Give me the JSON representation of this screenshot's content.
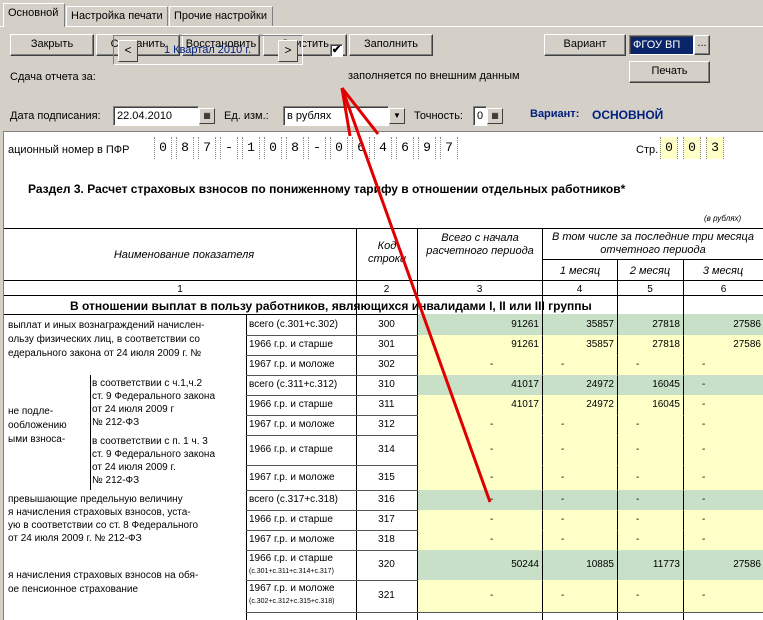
{
  "tabs": [
    "Основной",
    "Настройка печати",
    "Прочие настройки"
  ],
  "toolbar": {
    "close": "Закрыть",
    "save": "Сохранить",
    "restore": "Восстановить",
    "clear": "Очистить",
    "fill": "Заполнить",
    "variant": "Вариант",
    "variant_value": "ФГОУ ВП",
    "ellipsis": "...",
    "print": "Печать"
  },
  "period": {
    "label": "Сдача отчета за:",
    "value": "1 Квартал 2010 г.",
    "prev": "<",
    "next": ">"
  },
  "external": {
    "checked": "✔",
    "label": "заполняется по внешним данным"
  },
  "sign": {
    "date_label": "Дата подписания:",
    "date_value": "22.04.2010",
    "unit_label": "Ед. изм.:",
    "unit_value": "в рублях",
    "precision_label": "Точность:",
    "precision_value": "0",
    "variant_label": "Вариант:",
    "variant_value": "ОСНОВНОЙ"
  },
  "sheet": {
    "reg_label": "ационный номер в ПФР",
    "reg_digits": [
      "0",
      "8",
      "7",
      "-",
      "1",
      "0",
      "8",
      "-",
      "0",
      "6",
      "4",
      "6",
      "9",
      "7"
    ],
    "page_label": "Стр.",
    "page_digits": [
      "0",
      "0",
      "3"
    ],
    "section_title": "Раздел 3. Расчет страховых взносов по пониженному тарифу в отношении отдельных работников*",
    "units_note": "(в рублях)",
    "headers": {
      "name": "Наименование показателя",
      "code": "Код строки",
      "total": "Всего с начала расчетного периода",
      "last3": "В том числе за последние три месяца отчетного периода",
      "m1": "1 месяц",
      "m2": "2 месяц",
      "m3": "3 месяц",
      "n1": "1",
      "n2": "2",
      "n3": "3",
      "n4": "4",
      "n5": "5",
      "n6": "6"
    },
    "group_title": "В отношении выплат в пользу работников, являющихся инвалидами I, II или III группы",
    "block1_text": [
      "выплат и иных вознаграждений начислен-",
      "ользу физических лиц,  в соответствии со",
      "едерального закона от 24 июля  2009 г.  №"
    ],
    "block2_left": [
      "не подле-",
      "ообложению",
      "ыми взноса-"
    ],
    "block2a": [
      "в соответствии   с ч.1,ч.2",
      "ст. 9 Федерального закона",
      "от 24 июля 2009 г",
      "№  212-ФЗ"
    ],
    "block2b": [
      "в соответствии с п. 1 ч. 3",
      "ст. 9 Федерального закона",
      "от 24 июля 2009 г.",
      "№ 212-ФЗ"
    ],
    "block3_text": [
      "превышающие предельную величину",
      "я начисления страховых взносов, уста-",
      "ую в соответствии со ст. 8  Федерального",
      "от 24 июля 2009 г.  № 212-ФЗ"
    ],
    "block4_text": [
      "я начисления страховых взносов на обя-",
      "ое пенсионное страхование"
    ],
    "rows": [
      {
        "label": "всего (с.301+с.302)",
        "code": "300",
        "v": [
          "91261",
          "35857",
          "27818",
          "27586"
        ]
      },
      {
        "label": "1966 г.р. и старше",
        "code": "301",
        "v": [
          "91261",
          "35857",
          "27818",
          "27586"
        ]
      },
      {
        "label": "1967 г.р. и моложе",
        "code": "302",
        "v": [
          "-",
          "-",
          "-",
          "-"
        ]
      },
      {
        "label": "всего (с.311+с.312)",
        "code": "310",
        "v": [
          "41017",
          "24972",
          "16045",
          "-"
        ]
      },
      {
        "label": "1966 г.р. и старше",
        "code": "311",
        "v": [
          "41017",
          "24972",
          "16045",
          "-"
        ]
      },
      {
        "label": "1967 г.р. и моложе",
        "code": "312",
        "v": [
          "-",
          "-",
          "-",
          "-"
        ]
      },
      {
        "label": "1966 г.р. и старше",
        "code": "314",
        "v": [
          "-",
          "-",
          "-",
          "-"
        ]
      },
      {
        "label": "1967 г.р. и моложе",
        "code": "315",
        "v": [
          "-",
          "-",
          "-",
          "-"
        ]
      },
      {
        "label": "всего (с.317+с.318)",
        "code": "316",
        "v": [
          "-",
          "-",
          "-",
          "-"
        ]
      },
      {
        "label": "1966 г.р. и старше",
        "code": "317",
        "v": [
          "-",
          "-",
          "-",
          "-"
        ]
      },
      {
        "label": "1967 г.р. и моложе",
        "code": "318",
        "v": [
          "-",
          "-",
          "-",
          "-"
        ]
      },
      {
        "label": "1966 г.р. и старше",
        "sub": "(с.301+с.311+с.314+с.317)",
        "code": "320",
        "v": [
          "50244",
          "10885",
          "11773",
          "27586"
        ]
      },
      {
        "label": "1967 г.р. и моложе",
        "sub": "(с.302+с.312+с.315+с.318)",
        "code": "321",
        "v": [
          "-",
          "-",
          "-",
          "-"
        ]
      }
    ]
  },
  "colors": {
    "green": "#c8e0c8",
    "yellow": "#ffffc8",
    "arrow": "#e00000",
    "variant_blue": "#00207f"
  }
}
